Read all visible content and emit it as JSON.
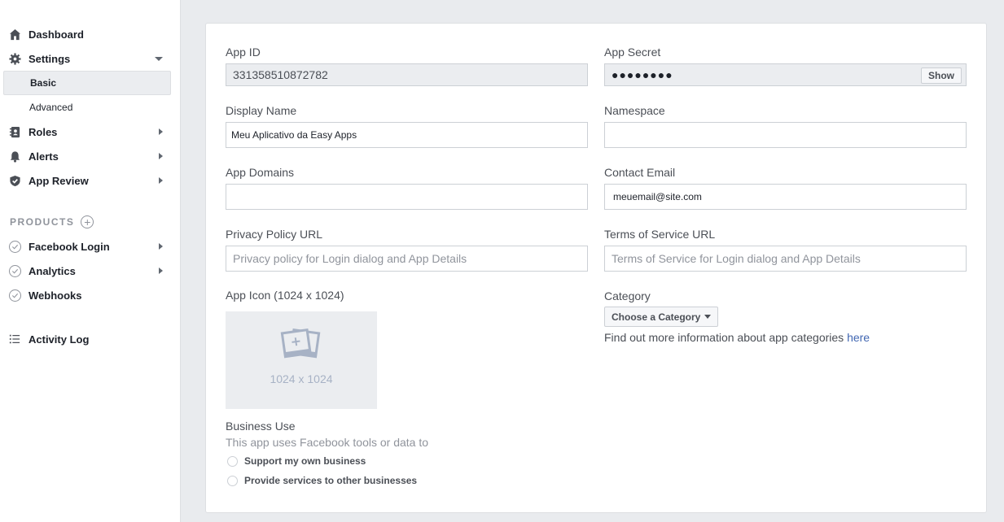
{
  "sidebar": {
    "dashboard": "Dashboard",
    "settings": "Settings",
    "settings_sub": [
      "Basic",
      "Advanced"
    ],
    "roles": "Roles",
    "alerts": "Alerts",
    "app_review": "App Review",
    "products_header": "PRODUCTS",
    "products": [
      "Facebook Login",
      "Analytics",
      "Webhooks"
    ],
    "activity_log": "Activity Log"
  },
  "form": {
    "app_id_label": "App ID",
    "app_id_value": "331358510872782",
    "app_secret_label": "App Secret",
    "app_secret_value": "●●●●●●●●",
    "show_button": "Show",
    "display_name_label": "Display Name",
    "display_name_value": "Meu Aplicativo da Easy Apps",
    "namespace_label": "Namespace",
    "namespace_value": "",
    "app_domains_label": "App Domains",
    "app_domains_value": "",
    "contact_email_label": "Contact Email",
    "contact_email_value": "meuemail@site.com",
    "privacy_label": "Privacy Policy URL",
    "privacy_placeholder": "Privacy policy for Login dialog and App Details",
    "tos_label": "Terms of Service URL",
    "tos_placeholder": "Terms of Service for Login dialog and App Details",
    "app_icon_label": "App Icon (1024 x 1024)",
    "app_icon_size": "1024 x 1024",
    "category_label": "Category",
    "category_button": "Choose a Category",
    "category_help": "Find out more information about app categories",
    "category_help_link": "here",
    "business_use_label": "Business Use",
    "business_use_desc": "This app uses Facebook tools or data to",
    "business_options": [
      "Support my own business",
      "Provide services to other businesses"
    ]
  },
  "colors": {
    "link": "#4267b2",
    "background": "#e9ebee",
    "sidebar_active": "#ebedf0"
  }
}
